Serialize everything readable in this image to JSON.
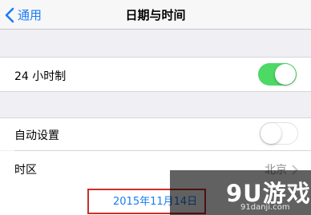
{
  "navbar": {
    "back_label": "通用",
    "title": "日期与时间"
  },
  "settings": {
    "hour24": {
      "label": "24 小时制",
      "state": "on"
    },
    "auto_set": {
      "label": "自动设置",
      "state": "off"
    },
    "timezone": {
      "label": "时区",
      "value": "北京"
    },
    "date_value": "2015年11月14日"
  },
  "watermark": {
    "logo": "9U游戏",
    "url": "91danji.com"
  },
  "colors": {
    "accent": "#1b7cf6",
    "switch_on": "#4cd964",
    "highlight_border": "#c8312a",
    "background": "#efeff4"
  }
}
